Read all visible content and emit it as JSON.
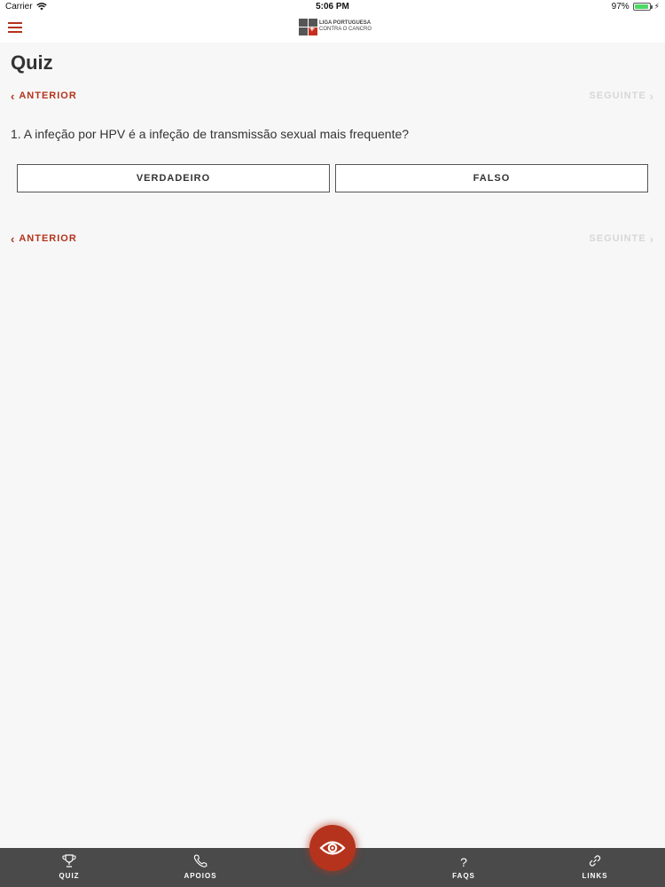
{
  "status_bar": {
    "carrier": "Carrier",
    "time": "5:06 PM",
    "battery_percent": "97%",
    "battery_level": 0.97,
    "icons": [
      "wifi-icon",
      "battery-icon",
      "charging-icon"
    ]
  },
  "header": {
    "logo_line1": "LIGA PORTUGUESA",
    "logo_line2": "CONTRA O CANCRO"
  },
  "page": {
    "title": "Quiz"
  },
  "pager": {
    "prev_label": "ANTERIOR",
    "next_label": "SEGUINTE"
  },
  "question": {
    "text": "1. A infeção por HPV é a infeção de transmissão sexual mais frequente?",
    "answers": [
      "VERDADEIRO",
      "FALSO"
    ]
  },
  "tabs": [
    {
      "label": "QUIZ",
      "icon": "trophy-icon"
    },
    {
      "label": "APOIOS",
      "icon": "phone-icon"
    },
    {
      "label": "FAQS",
      "icon": "question-icon",
      "glyph": "?"
    },
    {
      "label": "LINKS",
      "icon": "link-icon"
    }
  ],
  "colors": {
    "accent": "#b5331c",
    "disabled": "#d7d7d7",
    "tab_bar": "#4a4a4a",
    "background": "#f7f7f7"
  }
}
